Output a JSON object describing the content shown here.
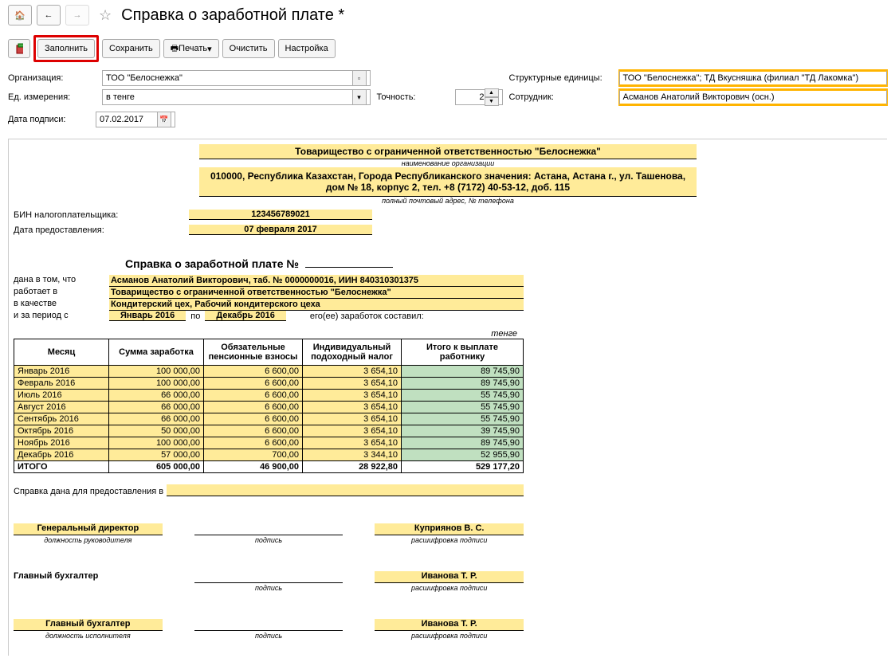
{
  "header": {
    "title": "Справка о заработной плате *"
  },
  "toolbar": {
    "fill": "Заполнить",
    "save": "Сохранить",
    "print": "Печать",
    "clear": "Очистить",
    "settings": "Настройка"
  },
  "form": {
    "org_label": "Организация:",
    "org_value": "ТОО \"Белоснежка\"",
    "unit_label": "Ед. измерения:",
    "unit_value": "в тенге",
    "precision_label": "Точность:",
    "precision_value": "2",
    "struct_label": "Структурные единицы:",
    "struct_value": "ТОО \"Белоснежка\"; ТД Вкусняшка (филиал \"ТД Лакомка\")",
    "employee_label": "Сотрудник:",
    "employee_value": "Асманов Анатолий Викторович (осн.)",
    "sign_date_label": "Дата подписи:",
    "sign_date_value": "07.02.2017"
  },
  "doc": {
    "org_name": "Товарищество с ограниченной ответственностью \"Белоснежка\"",
    "org_name_note": "наименование организации",
    "address": "010000, Республика Казахстан, Города Республиканского значения: Астана, Астана г., ул. Ташенова, дом № 18, корпус 2, тел. +8 (7172) 40-53-12, доб. 115",
    "address_note": "полный почтовый адрес, № телефона",
    "bin_label": "БИН налогоплательщика:",
    "bin_value": "123456789021",
    "provided_label": "Дата предоставления:",
    "provided_value": "07 февраля 2017",
    "ref_title": "Справка о заработной плате №",
    "given_label1": "дана в том, что",
    "given_value1": "Асманов Анатолий Викторович, таб. № 0000000016, ИИН 840310301375",
    "given_label2": "работает в",
    "given_value2": "Товарищество с ограниченной ответственностью \"Белоснежка\"",
    "given_label3": "в качестве",
    "given_value3": "Кондитерский цех, Рабочий кондитерского цеха",
    "period_label": "и за период с",
    "period_from": "Январь 2016",
    "period_sep": "по",
    "period_to": "Декабрь 2016",
    "period_suffix": "его(ее) заработок составил:",
    "currency": "тенге",
    "purpose_label": "Справка дана для предоставления в"
  },
  "table": {
    "headers": {
      "month": "Месяц",
      "amount": "Сумма заработка",
      "pension": "Обязательные пенсионные взносы",
      "tax": "Индивидуальный подоходный налог",
      "payout": "Итого к выплате работнику"
    },
    "rows": [
      {
        "month": "Январь 2016",
        "amount": "100 000,00",
        "pension": "6 600,00",
        "tax": "3 654,10",
        "payout": "89 745,90"
      },
      {
        "month": "Февраль 2016",
        "amount": "100 000,00",
        "pension": "6 600,00",
        "tax": "3 654,10",
        "payout": "89 745,90"
      },
      {
        "month": "Июль 2016",
        "amount": "66 000,00",
        "pension": "6 600,00",
        "tax": "3 654,10",
        "payout": "55 745,90"
      },
      {
        "month": "Август 2016",
        "amount": "66 000,00",
        "pension": "6 600,00",
        "tax": "3 654,10",
        "payout": "55 745,90"
      },
      {
        "month": "Сентябрь 2016",
        "amount": "66 000,00",
        "pension": "6 600,00",
        "tax": "3 654,10",
        "payout": "55 745,90"
      },
      {
        "month": "Октябрь 2016",
        "amount": "50 000,00",
        "pension": "6 600,00",
        "tax": "3 654,10",
        "payout": "39 745,90"
      },
      {
        "month": "Ноябрь 2016",
        "amount": "100 000,00",
        "pension": "6 600,00",
        "tax": "3 654,10",
        "payout": "89 745,90"
      },
      {
        "month": "Декабрь 2016",
        "amount": "57 000,00",
        "pension": "700,00",
        "tax": "3 344,10",
        "payout": "52 955,90"
      }
    ],
    "total": {
      "label": "ИТОГО",
      "amount": "605 000,00",
      "pension": "46 900,00",
      "tax": "28 922,80",
      "payout": "529 177,20"
    }
  },
  "signatures": {
    "gendir_role": "Генеральный директор",
    "role_note1": "должность руководителя",
    "sign_note": "подпись",
    "gendir_name": "Куприянов В. С.",
    "decode_note": "расшифровка подписи",
    "chief_acc": "Главный бухгалтер",
    "ivanova": "Иванова Т. Р.",
    "role_note2": "должность исполнителя"
  }
}
